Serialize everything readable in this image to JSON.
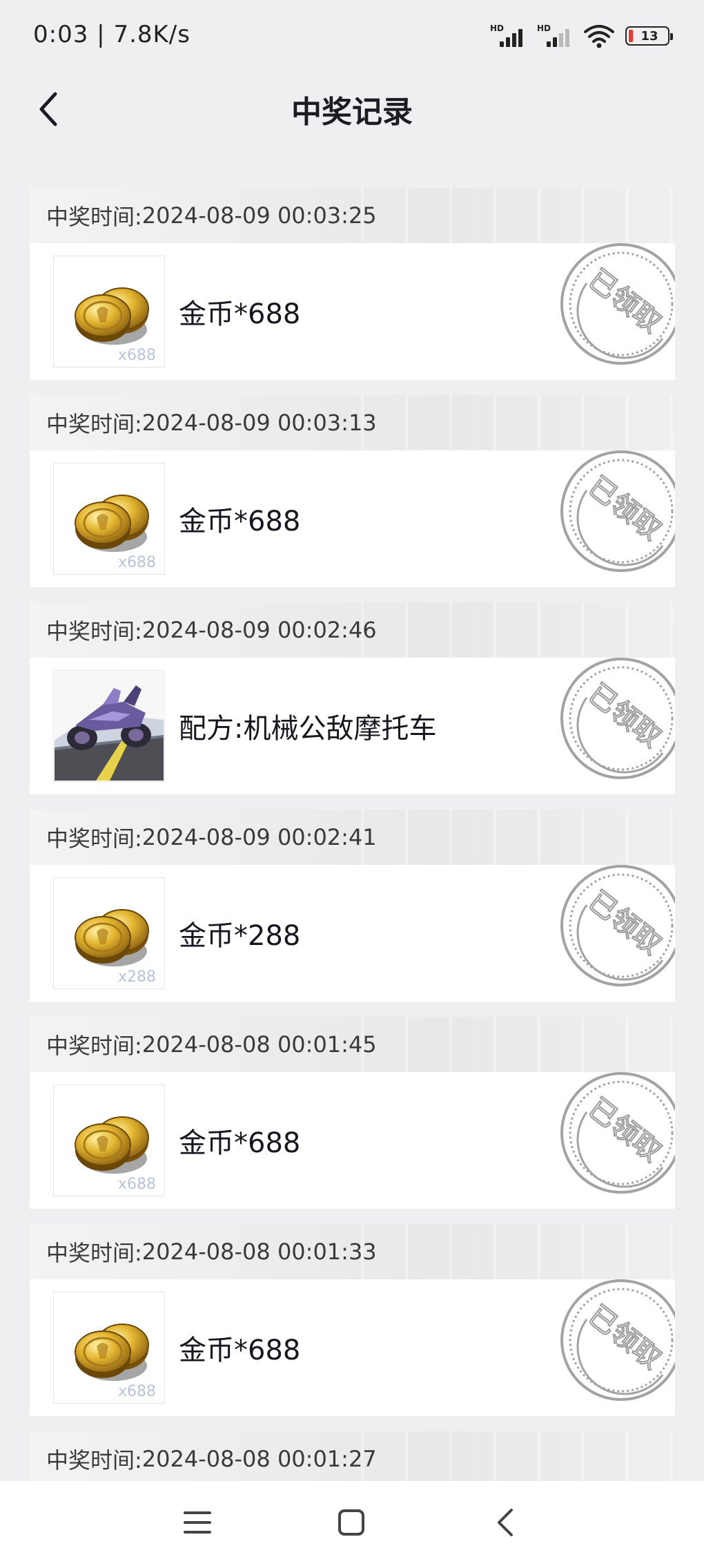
{
  "status_bar": {
    "time": "0:03",
    "speed": "7.8K/s",
    "signal1_label": "HD",
    "signal2_label": "HD",
    "battery_level": "13"
  },
  "header": {
    "title": "中奖记录",
    "back_icon": "chevron-left-icon"
  },
  "records": [
    {
      "label": "中奖时间:",
      "time": "2024-08-09 00:03:25",
      "prize": "金币*688",
      "image": "gold-coins",
      "image_qty": "x688",
      "stamp": "已领取"
    },
    {
      "label": "中奖时间:",
      "time": "2024-08-09 00:03:13",
      "prize": "金币*688",
      "image": "gold-coins",
      "image_qty": "x688",
      "stamp": "已领取"
    },
    {
      "label": "中奖时间:",
      "time": "2024-08-09 00:02:46",
      "prize": "配方:机械公敌摩托车",
      "image": "motorcycle",
      "image_qty": "",
      "stamp": "已领取"
    },
    {
      "label": "中奖时间:",
      "time": "2024-08-09 00:02:41",
      "prize": "金币*288",
      "image": "gold-coins",
      "image_qty": "x288",
      "stamp": "已领取"
    },
    {
      "label": "中奖时间:",
      "time": "2024-08-08 00:01:45",
      "prize": "金币*688",
      "image": "gold-coins",
      "image_qty": "x688",
      "stamp": "已领取"
    },
    {
      "label": "中奖时间:",
      "time": "2024-08-08 00:01:33",
      "prize": "金币*688",
      "image": "gold-coins",
      "image_qty": "x688",
      "stamp": "已领取"
    },
    {
      "label": "中奖时间:",
      "time": "2024-08-08 00:01:27",
      "prize": "",
      "image": "",
      "image_qty": "",
      "stamp": ""
    }
  ],
  "nav_bar": {
    "menu_icon": "menu-icon",
    "home_icon": "home-square-icon",
    "back_icon": "back-triangle-icon"
  },
  "colors": {
    "background": "#efeff1",
    "card": "#ffffff",
    "stamp": "#9e9e9e",
    "battery_low": "#e53935"
  }
}
